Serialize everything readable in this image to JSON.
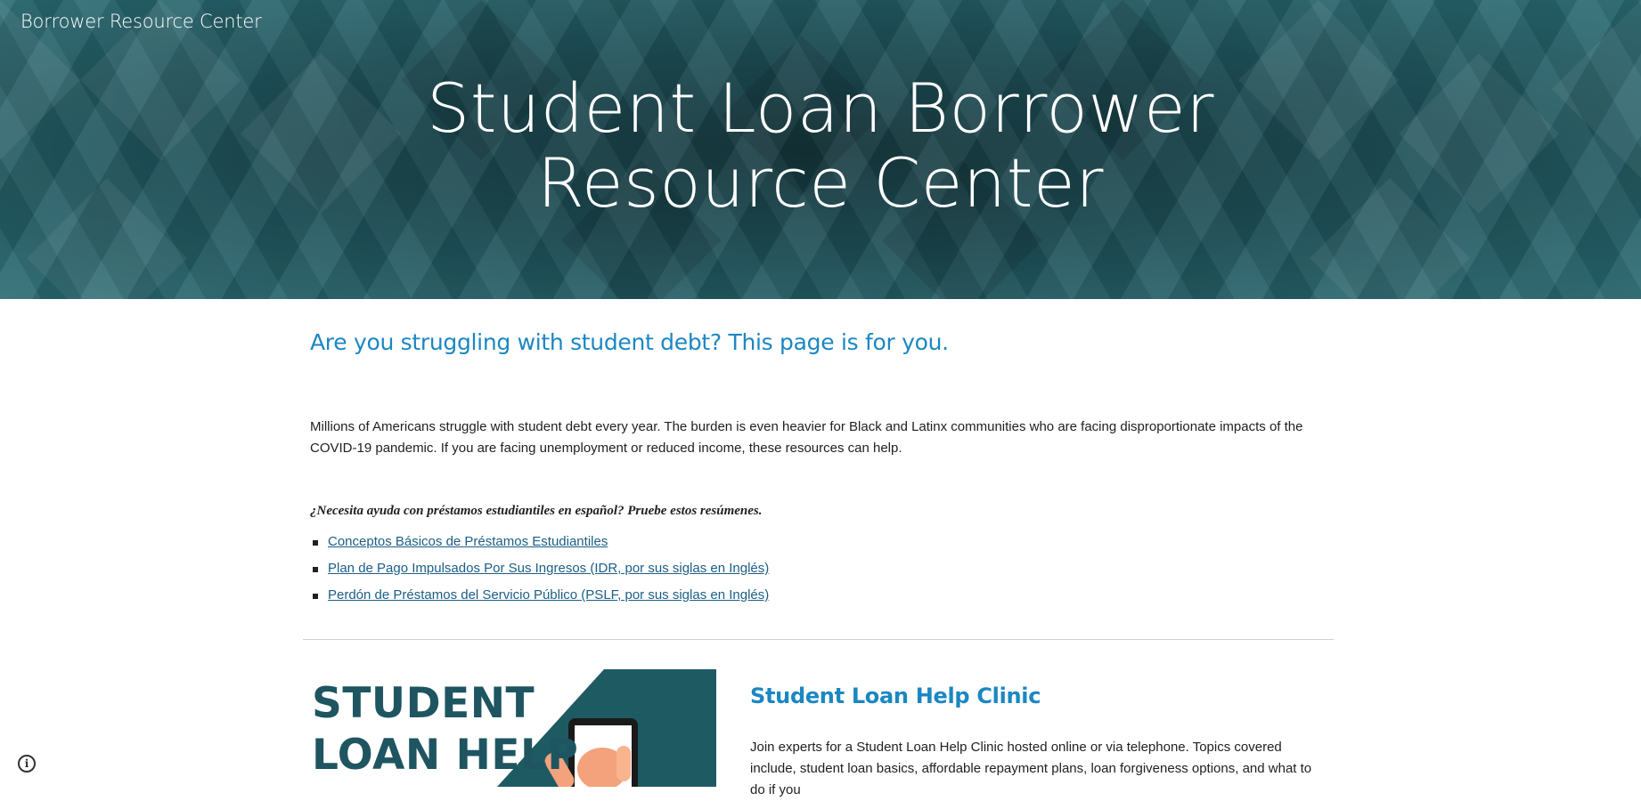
{
  "header": {
    "site_title": "Borrower Resource Center",
    "hero_title_line1": "Student Loan Borrower",
    "hero_title_line2": "Resource Center"
  },
  "main": {
    "lead_heading": "Are you struggling with student debt? This page is for you.",
    "intro_text": "Millions of Americans struggle with student debt every year.  The burden is even heavier for Black and Latinx communities who are facing disproportionate impacts of the COVID-19 pandemic. If you are facing unemployment or reduced income, these resources can help.",
    "spanish_prompt": "¿Necesita ayuda con préstamos estudiantiles en español? Pruebe estos resúmenes.",
    "spanish_links": [
      {
        "label": "Conceptos Básicos de Préstamos Estudiantiles"
      },
      {
        "label": "Plan de Pago Impulsados Por Sus Ingresos (IDR, por sus siglas en Inglés)"
      },
      {
        "label": "Perdón de Préstamos del Servicio Público (PSLF, por sus siglas en Inglés)"
      }
    ]
  },
  "clinic": {
    "image_text_line1": "STUDENT",
    "image_text_line2": "LOAN HELP",
    "heading": "Student Loan Help Clinic",
    "body": "Join experts for a Student Loan Help Clinic hosted online or via telephone. Topics covered include, student loan basics, affordable repayment plans, loan forgiveness options, and what to do if you"
  },
  "footer": {
    "info_icon": "info-icon"
  },
  "colors": {
    "hero_dark": "#173a40",
    "hero_teal": "#2a6b73",
    "heading_blue": "#1b87c2",
    "link_blue": "#1c5e86",
    "image_teal": "#1e5560"
  }
}
